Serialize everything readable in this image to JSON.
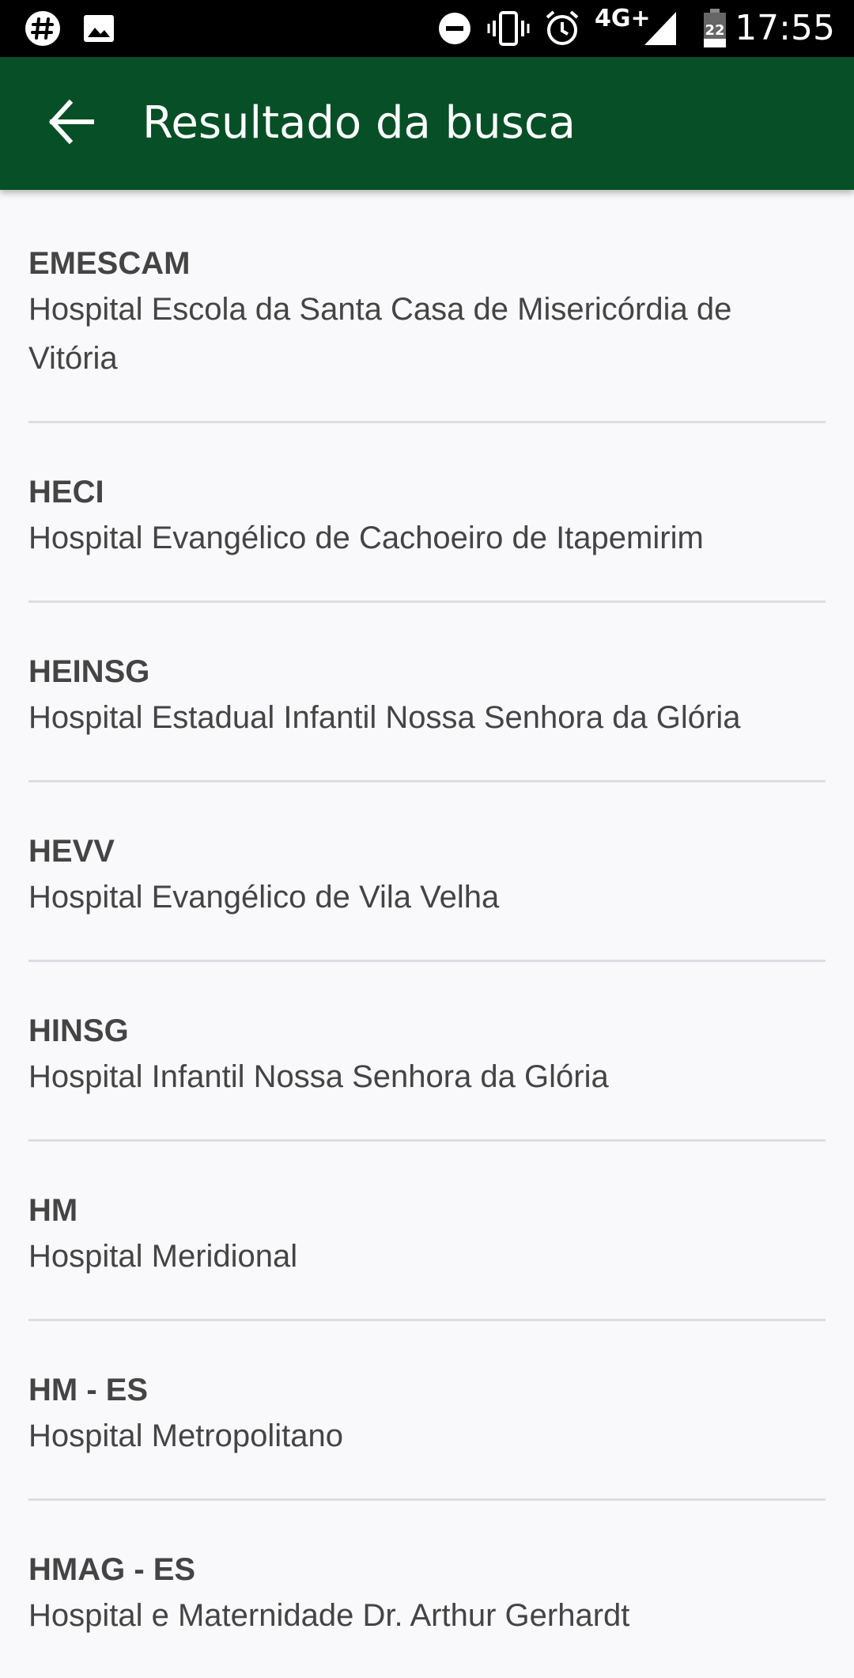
{
  "status_bar": {
    "time": "17:55",
    "network": "4G+",
    "battery_level": "22",
    "icons": [
      "slack-icon",
      "image-icon",
      "do-not-disturb-icon",
      "vibrate-icon",
      "alarm-icon",
      "signal-icon",
      "battery-icon"
    ]
  },
  "app_bar": {
    "title": "Resultado da busca",
    "back_icon": "arrow-back-icon",
    "background_color": "#064f27"
  },
  "results": [
    {
      "acronym": "EMESCAM",
      "name": "Hospital Escola da Santa Casa de Misericórdia de Vitória"
    },
    {
      "acronym": "HECI",
      "name": "Hospital Evangélico de Cachoeiro de Itapemirim"
    },
    {
      "acronym": "HEINSG",
      "name": "Hospital Estadual Infantil Nossa Senhora da Glória"
    },
    {
      "acronym": "HEVV",
      "name": "Hospital Evangélico de Vila Velha"
    },
    {
      "acronym": "HINSG",
      "name": "Hospital Infantil Nossa Senhora da Glória"
    },
    {
      "acronym": "HM",
      "name": "Hospital Meridional"
    },
    {
      "acronym": "HM - ES",
      "name": "Hospital Metropolitano"
    },
    {
      "acronym": "HMAG - ES",
      "name": "Hospital e Maternidade Dr. Arthur Gerhardt"
    }
  ]
}
